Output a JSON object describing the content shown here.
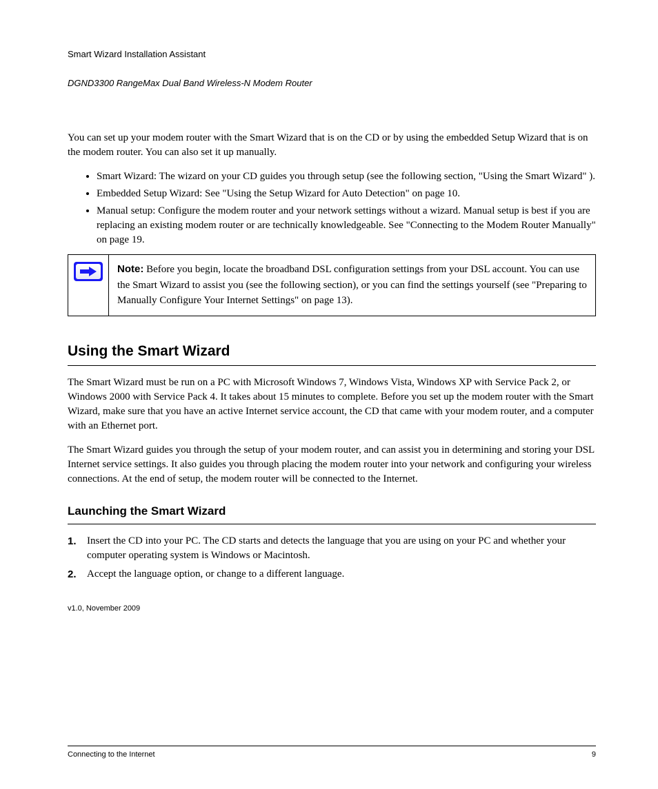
{
  "header": {
    "doc_title": "Smart Wizard Installation Assistant",
    "product": "DGND3300 RangeMax Dual Band Wireless-N Modem Router"
  },
  "intro": "You can set up your modem router with the Smart Wizard that is on the CD or by using the embedded Setup Wizard that is on the modem router. You can also set it up manually.",
  "bullets": [
    "Smart Wizard: The wizard on your CD guides you through setup (see the following section, \"Using the Smart Wizard\" ).",
    "Embedded Setup Wizard: See \"Using the Setup Wizard for Auto Detection\" on page 10.",
    "Manual setup: Configure the modem router and your network settings without a wizard. Manual setup is best if you are replacing an existing modem router or are technically knowledgeable. See \"Connecting to the Modem Router Manually\" on page 19."
  ],
  "note": {
    "label": "Note:",
    "text": "Before you begin, locate the broadband DSL configuration settings from your DSL account. You can use the Smart Wizard to assist you (see the following section), or you can find the settings yourself (see \"Preparing to Manually Configure Your Internet Settings\" on page 13)."
  },
  "section": {
    "title": "Using the Smart Wizard",
    "p1": "The Smart Wizard must be run on a PC with Microsoft Windows 7, Windows Vista, Windows XP with Service Pack 2, or Windows 2000 with Service Pack 4. It takes about 15 minutes to complete. Before you set up the modem router with the Smart Wizard, make sure that you have an active Internet service account, the CD that came with your modem router, and a computer with an Ethernet port.",
    "p2": "The Smart Wizard guides you through the setup of your modem router, and can assist you in determining and storing your DSL Internet service settings. It also guides you through placing the modem router into your network and configuring your wireless connections. At the end of setup, the modem router will be connected to the Internet."
  },
  "subsection": {
    "title": "Launching the Smart Wizard",
    "steps": [
      "Insert the CD into your PC. The CD starts and detects the language that you are using on your PC and whether your computer operating system is Windows or Macintosh.",
      "Accept the language option, or change to a different language."
    ]
  },
  "last_updated": "v1.0, November 2009",
  "footer": {
    "left": "Connecting to the Internet",
    "right": "9"
  },
  "icons": {
    "arrow": "arrow-right-icon"
  }
}
